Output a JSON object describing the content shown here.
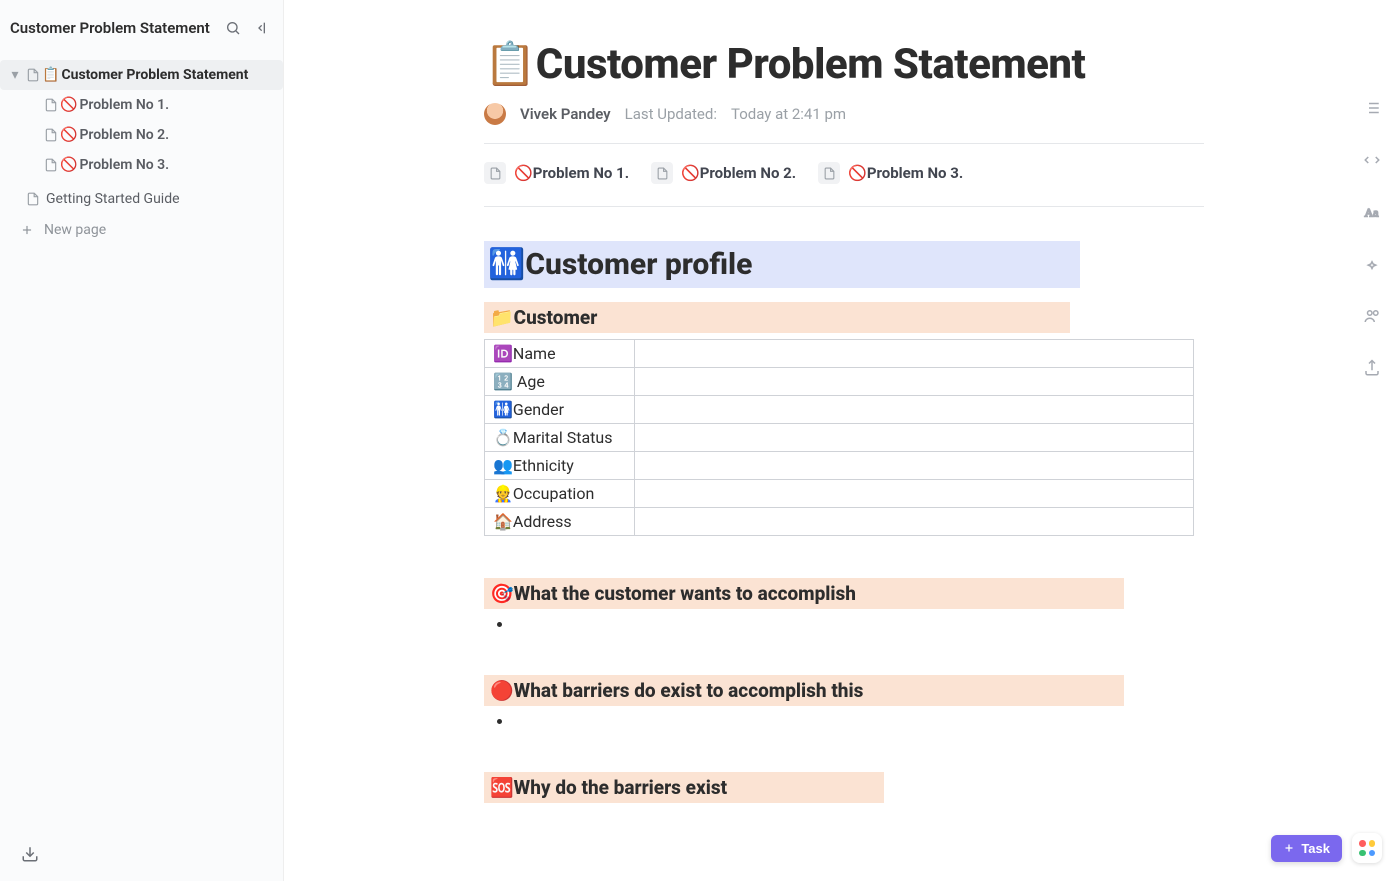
{
  "workspace_title": "Customer Problem Statement",
  "sidebar": {
    "root": {
      "emoji": "📋",
      "label": "Customer Problem Statement"
    },
    "children": [
      {
        "emoji": "🚫",
        "label": "Problem No 1."
      },
      {
        "emoji": "🚫",
        "label": "Problem No 2."
      },
      {
        "emoji": "🚫",
        "label": "Problem No 3."
      }
    ],
    "other_pages": [
      {
        "label": "Getting Started Guide"
      }
    ],
    "new_page_label": "New page"
  },
  "page": {
    "title_emoji": "📋",
    "title": "Customer Problem Statement",
    "author": "Vivek Pandey",
    "updated_label": "Last Updated:",
    "updated_value": "Today at 2:41 pm",
    "subpages": [
      {
        "emoji": "🚫",
        "label": "Problem No 1."
      },
      {
        "emoji": "🚫",
        "label": "Problem No 2."
      },
      {
        "emoji": "🚫",
        "label": "Problem No 3."
      }
    ],
    "section_profile": {
      "emoji": "🚻",
      "label": "Customer profile"
    },
    "customer_heading": {
      "emoji": "📁",
      "label": "Customer"
    },
    "customer_fields": [
      {
        "emoji": "🆔",
        "label": "Name",
        "value": ""
      },
      {
        "emoji": "🔢",
        "label": " Age",
        "value": ""
      },
      {
        "emoji": "🚻",
        "label": "Gender",
        "value": ""
      },
      {
        "emoji": "💍",
        "label": "Marital Status",
        "value": ""
      },
      {
        "emoji": "👥",
        "label": "Ethnicity",
        "value": ""
      },
      {
        "emoji": "👷",
        "label": "Occupation",
        "value": ""
      },
      {
        "emoji": "🏠",
        "label": "Address",
        "value": ""
      }
    ],
    "q1": {
      "emoji": "🎯",
      "label": "What the customer wants to accomplish"
    },
    "q2": {
      "emoji": "🔴",
      "label": "What barriers do exist to accomplish this"
    },
    "q3": {
      "emoji": "🆘",
      "label": "Why do the barriers exist"
    }
  },
  "task_button_label": "Task"
}
